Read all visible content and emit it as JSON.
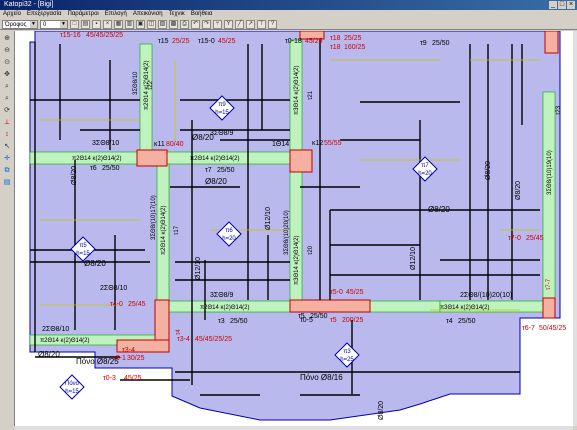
{
  "window": {
    "title": "Katopi32 - [Bigi]"
  },
  "menu": [
    "Αρχείο",
    "Επεξεργασία",
    "Παράμετροι",
    "Επιλογή",
    "Απεικόνιση",
    "Τεχνικ",
    "Βοήθεια"
  ],
  "toolbar": {
    "layer_combo": "Όροφος",
    "level_combo": "0"
  },
  "drawing": {
    "slabs": [
      {
        "id": "π5",
        "h": "h=15"
      },
      {
        "id": "π6",
        "h": "h=20"
      },
      {
        "id": "π7",
        "h": "h=20"
      },
      {
        "id": "π9",
        "h": "h=15"
      },
      {
        "id": "π3",
        "h": "h=25"
      },
      {
        "id": "Πόνο",
        "h": "h=15"
      }
    ],
    "columns": [
      {
        "id": "κ11",
        "dims": "80/40"
      },
      {
        "id": "κ12",
        "dims": "55/55"
      }
    ],
    "labels": {
      "t15_16": "τ15-16",
      "t15_16_dims": "45/45/25/25",
      "t15": "τ15",
      "t15_dims": "25/25",
      "t15_0": "τ15-0",
      "t15_0_dims": "45/25",
      "t0_18": "τ0-18",
      "t0_18_dims": "45/25",
      "t18a": "τ18",
      "t18a_dims": "25/25",
      "t18b": "τ18",
      "t18b_dims": "160/25",
      "t9": "τ9",
      "t9_dims": "25/50",
      "t7": "τ7",
      "t7_dims": "25/50",
      "t6": "τ6",
      "t6_dims": "25/50",
      "t7_0": "τ7-0",
      "t7_0_dims": "25/45",
      "t7_7": "τ7-7",
      "t7_7_dims": "25/100",
      "t6_7": "τ6-7",
      "t6_7_dims": "50/45/25",
      "t4_0": "τ4-0",
      "t4_0_dims": "25/45",
      "t3": "τ3",
      "t3_dims": "25/50",
      "t4": "τ4",
      "t4_dims": "25/50",
      "t5": "τ5",
      "t5_dims": "25/50",
      "t5_0": "τ5-0",
      "t5_0_dims": "45/25",
      "t5b": "τ5",
      "t5b_dims": "200/25",
      "t3_4": "τ3-4",
      "t3_4_dims": "45/45/25/25",
      "t3_4b": "τ3-4",
      "t3_1": "τ3-1",
      "t3_1_dims": "30/25",
      "t0_3": "τ0-3",
      "t0_3_dims": "45/25",
      "t21": "τ21",
      "t21_dims": "25/50",
      "t22": "τ22",
      "t22_dims": "25/50",
      "t23": "τ23",
      "t23_dims": "25/50",
      "t17": "τ17",
      "t17_dims": "25/50",
      "t20": "τ20",
      "t20_dims": "25/50",
      "t0_5": "τ0-5"
    },
    "reinf": {
      "r1": "Ø8/20",
      "r2": "Ø8/20",
      "r3": "Ø8/20",
      "r4": "Ø8/20",
      "r5": "Ø8/20",
      "r6": "Ø12/10",
      "r7": "Ø12/10",
      "r8": "Ø12/10",
      "r9": "Ø8/20",
      "r10": "Ø8/20",
      "r11": "Ø8/20",
      "r12": "Ø8/20",
      "pono1": "Πόνο Ø8/25",
      "pono2": "Πόνο Ø8/16",
      "b1": "3ΣΘ8/10",
      "b2": "3ΣΘ8/9",
      "b3": "2ΣΘ8/10",
      "b4": "2ΣΘ8/20",
      "b5": "1Θ14",
      "b6": "3ΣΘ8/9",
      "b7": "2ΣΘ8/(10)20(10)",
      "s1": "π2Θ14 κ(2)Θ14(2)",
      "s2": "π2Θ14 κ(2)Θ14(2)",
      "s3": "π2Θ14 κ(2)Θ14(2)",
      "s4": "π3Θ14 κ(2)Θ14(2)",
      "s5": "π2Θ14 κ(2)Θ14(2)",
      "s6": "π3Θ14 κ(2)Θ14(2)",
      "s7": "π2Θ14 κ(2)Θ14(2)",
      "v1": "3ΣΘ8/10",
      "v2": "3ΣΘ8/(10)20(10)",
      "v3": "3ΣΘ8/(10)19(10)",
      "v4": "3ΣΘ8/10",
      "v5": "3ΣΘ8/10",
      "v6": "π3Θ14 κ(2)Θ14(2)",
      "v7": "π2Θ14 κ(2)Θ14(2)",
      "v8": "3ΣΘ8/(10)17(10)"
    }
  },
  "colors": {
    "slab": "#b9b9ee",
    "beam": "#bff2bf",
    "red": "#d00000",
    "black": "#000000",
    "yellow": "#c8c800"
  }
}
